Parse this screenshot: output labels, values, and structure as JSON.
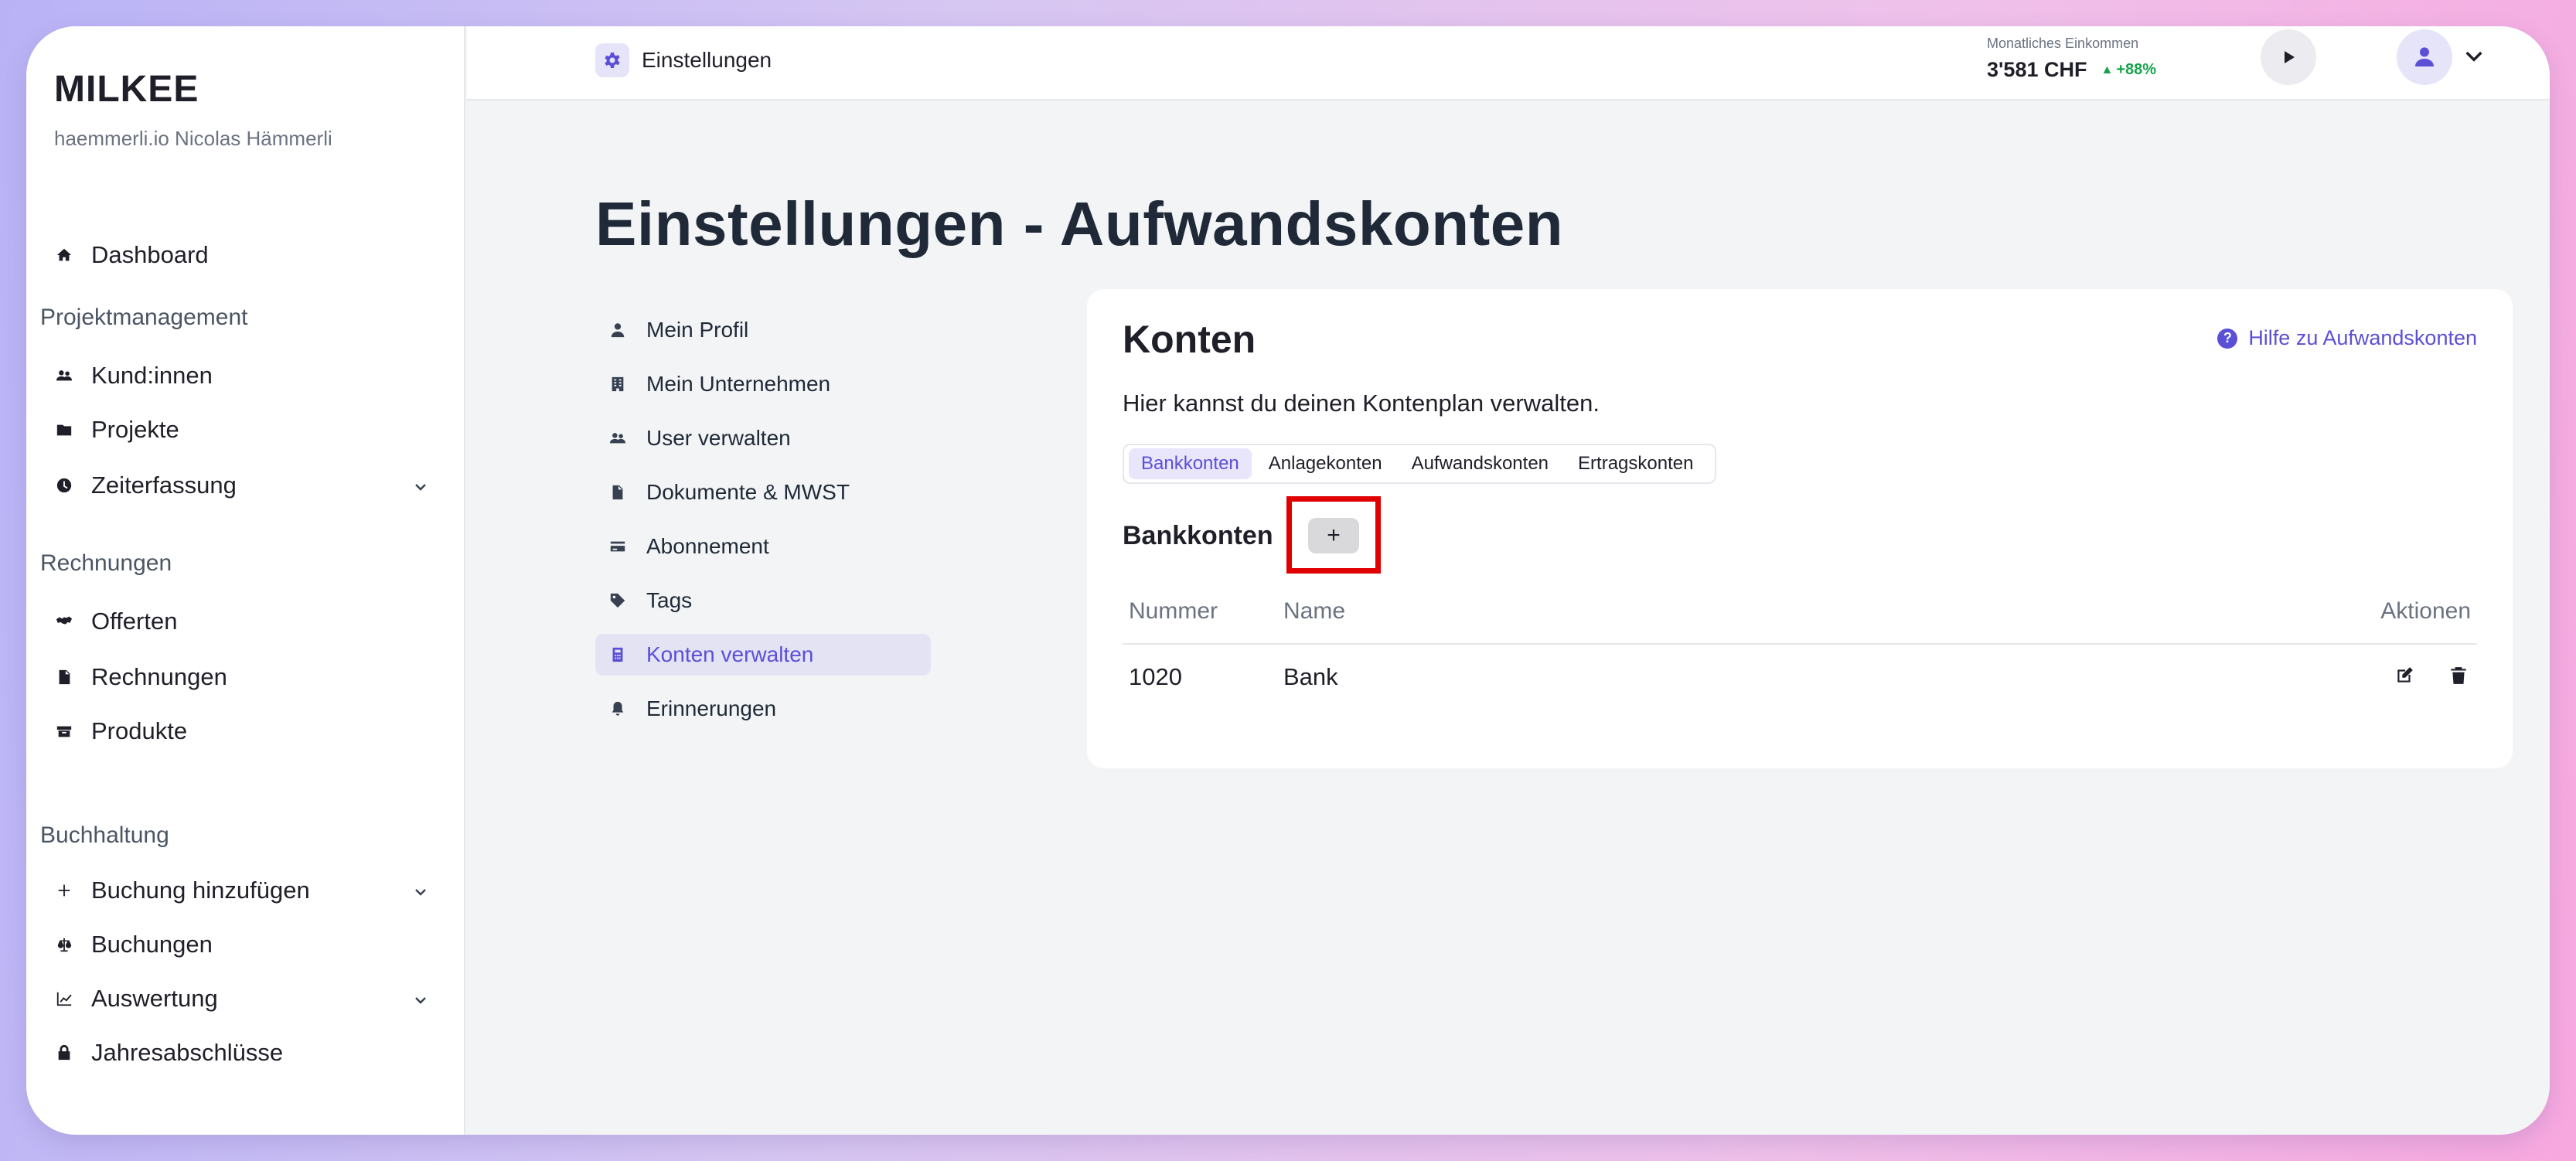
{
  "sidebar": {
    "brand": "MILKEE",
    "org": "haemmerli.io Nicolas Hämmerli",
    "dashboard": "Dashboard",
    "sections": {
      "projekt": "Projektmanagement",
      "rechnungen": "Rechnungen",
      "buchhaltung": "Buchhaltung"
    },
    "items": {
      "kunden": "Kund:innen",
      "projekte": "Projekte",
      "zeiterfassung": "Zeiterfassung",
      "offerten": "Offerten",
      "rechnungen": "Rechnungen",
      "produkte": "Produkte",
      "buchung_hinzufuegen": "Buchung hinzufügen",
      "buchungen": "Buchungen",
      "auswertung": "Auswertung",
      "jahresabschluesse": "Jahresabschlüsse"
    }
  },
  "topbar": {
    "crumb": "Einstellungen",
    "income_label": "Monatliches Einkommen",
    "income_value": "3'581 CHF",
    "income_change": "+88%"
  },
  "page": {
    "title": "Einstellungen - Aufwandskonten"
  },
  "settings_nav": {
    "profil": "Mein Profil",
    "unternehmen": "Mein Unternehmen",
    "user": "User verwalten",
    "dokumente": "Dokumente & MWST",
    "abonnement": "Abonnement",
    "tags": "Tags",
    "konten": "Konten verwalten",
    "erinnerungen": "Erinnerungen"
  },
  "card": {
    "title": "Konten",
    "help": "Hilfe zu Aufwandskonten",
    "description": "Hier kannst du deinen Kontenplan verwalten.",
    "tabs": [
      "Bankkonten",
      "Anlagekonten",
      "Aufwandskonten",
      "Ertragskonten"
    ],
    "section_title": "Bankkonten",
    "add_label": "+",
    "table": {
      "headers": {
        "nummer": "Nummer",
        "name": "Name",
        "aktionen": "Aktionen"
      },
      "rows": [
        {
          "nummer": "1020",
          "name": "Bank"
        }
      ]
    }
  },
  "colors": {
    "accent": "#5b4fd6",
    "accent_bg": "#e4e3f4",
    "highlight": "#e00000",
    "positive": "#16a34a"
  }
}
